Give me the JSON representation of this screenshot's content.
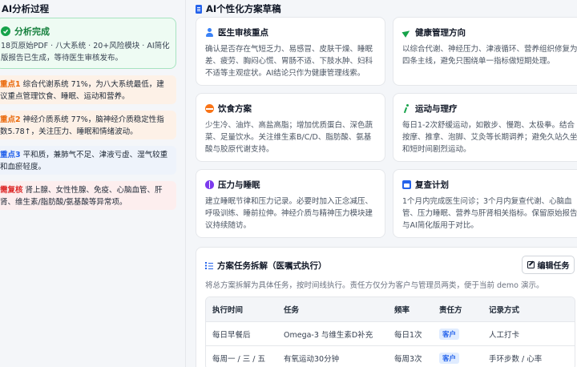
{
  "left": {
    "title": "AI分析过程",
    "done": {
      "title": "分析完成",
      "desc": "18页原始PDF · 八大系统 · 20+风险模块 · AI简化版报告已生成，等待医生审核发布。"
    },
    "points": [
      {
        "tag": "重点1",
        "text": " 综合代谢系统 71%，为八大系统最低，建议重点管理饮食、睡眠、运动和营养。"
      },
      {
        "tag": "重点2",
        "text": " 神经介质系统 77%，脑神经介质稳定性指数5.78↑，关注压力、睡眠和情绪波动。"
      },
      {
        "tag": "重点3",
        "text": " 平和质，兼肺气不足、津液亏虚、湿气较重和血瘀轻度。"
      },
      {
        "tag": "需复核",
        "text": " 肾上腺、女性性腺、免疫、心脑血管、肝肾、维生素/脂肪酸/氨基酸等异常项。"
      }
    ]
  },
  "right": {
    "title": "AI个性化方案草稿",
    "cards": [
      {
        "title": "医生审核重点",
        "body": "确认是否存在气短乏力、易感冒、皮肤干燥、睡眠差、疲劳、胸闷心慌、胃肠不适、下肢水肿、妇科不适等主观症状。AI结论只作为健康管理线索。"
      },
      {
        "title": "健康管理方向",
        "body": "以综合代谢、神经压力、津液循环、营养组织修复为四条主线，避免只围绕单一指标做短期处理。"
      },
      {
        "title": "饮食方案",
        "body": "少生冷、油炸、高盐高脂；增加优质蛋白、深色蔬菜、足量饮水。关注维生素B/C/D、脂肪酸、氨基酸与胶原代谢支持。"
      },
      {
        "title": "运动与理疗",
        "body": "每日1-2次舒缓运动，如散步、慢跑、太极拳。结合按摩、推拿、泡脚、艾灸等长期调养；避免久站久坐和短时间剧烈运动。"
      },
      {
        "title": "压力与睡眠",
        "body": "建立睡眠节律和压力记录。必要时加入正念减压、呼吸训练、睡前拉伸。神经介质与精神压力模块建议持续随访。"
      },
      {
        "title": "复查计划",
        "body": "1个月内完成医生问诊；3个月内复查代谢、心脑血管、压力睡眠、营养与肝肾相关指标。保留原始报告与AI简化版用于对比。"
      }
    ]
  },
  "task": {
    "title": "方案任务拆解（医嘱式执行）",
    "edit_label": "编辑任务",
    "desc": "将总方案拆解为具体任务，按时间线执行。责任方仅分为客户与管理员两类，便于当前 demo 演示。",
    "headers": [
      "执行时间",
      "任务",
      "频率",
      "责任方",
      "记录方式"
    ],
    "rows": [
      [
        "每日早餐后",
        "Omega-3 与维生素D补充",
        "每日1次",
        "客户",
        "人工打卡"
      ],
      [
        "每周一 / 三 / 五",
        "有氧运动30分钟",
        "每周3次",
        "客户",
        "手环步数 / 心率"
      ]
    ]
  }
}
